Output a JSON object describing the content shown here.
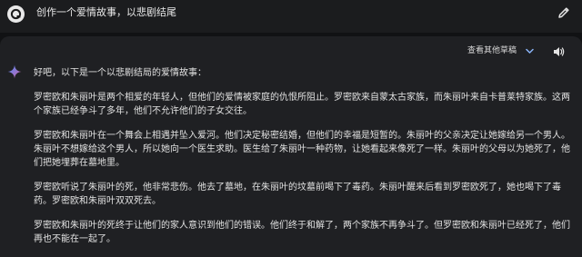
{
  "user_prompt": "创作一个爱情故事，以悲剧结尾",
  "toolbar": {
    "drafts_label": "查看其他草稿",
    "icons": [
      "user-avatar-icon",
      "edit-pencil-icon",
      "chevron-down-icon",
      "speaker-icon",
      "sparkle-icon"
    ]
  },
  "response": {
    "paragraphs": [
      "好吧，以下是一个以悲剧结局的爱情故事：",
      "罗密欧和朱丽叶是两个相爱的年轻人，但他们的爱情被家庭的仇恨所阻止。罗密欧来自蒙太古家族，而朱丽叶来自卡普莱特家族。这两个家族已经争斗了多年，他们不允许他们的子女交往。",
      "罗密欧和朱丽叶在一个舞会上相遇并坠入爱河。他们决定秘密结婚，但他们的幸福是短暂的。朱丽叶的父亲决定让她嫁给另一个男人。朱丽叶不想嫁给这个男人，所以她向一个医生求助。医生给了朱丽叶一种药物，让她看起来像死了一样。朱丽叶的父母以为她死了，他们把她埋葬在墓地里。",
      "罗密欧听说了朱丽叶的死，他非常悲伤。他去了墓地，在朱丽叶的坟墓前喝下了毒药。朱丽叶醒来后看到罗密欧死了，她也喝下了毒药。罗密欧和朱丽叶双双死去。",
      "罗密欧和朱丽叶的死终于让他们的家人意识到他们的错误。他们终于和解了，两个家族不再争斗了。但罗密欧和朱丽叶已经死了，他们再也不能在一起了。"
    ]
  },
  "colors": {
    "page_bg": "#111214",
    "topbar_bg": "#1b1c1e",
    "panel_bg": "#1f2023",
    "text": "#e2e2e2",
    "sparkle_blue": "#4e8df5",
    "sparkle_pink": "#d96570"
  }
}
